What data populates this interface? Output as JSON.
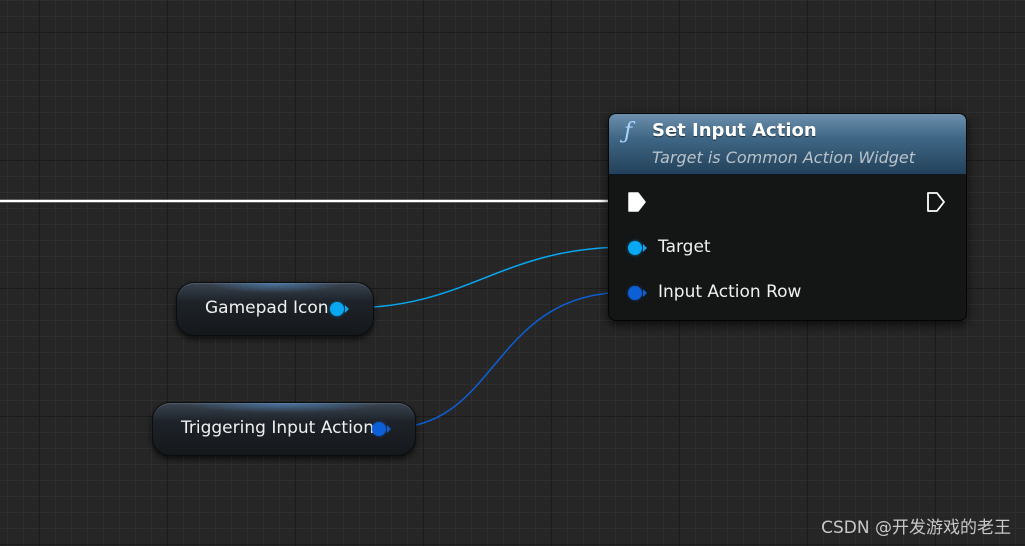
{
  "graph": {
    "background_color": "#262626",
    "grid_major_color": "#1b1b1b",
    "grid_minor_color": "#2e2e2e"
  },
  "function_node": {
    "icon": "function-f-icon",
    "icon_glyph": "ƒ",
    "title": "Set Input Action",
    "subtitle": "Target is Common Action Widget",
    "header_color": "#3f6785",
    "pins": {
      "exec_in": "exec-in-pin",
      "exec_out": "exec-out-pin",
      "target_label": "Target",
      "input_action_row_label": "Input Action Row"
    }
  },
  "variable_nodes": [
    {
      "label": "Gamepad Icon",
      "pin_color": "#07a7f2"
    },
    {
      "label": "Triggering Input Action",
      "pin_color": "#0d5fd6"
    }
  ],
  "wires": {
    "exec_color": "#ffffff",
    "object_color": "#07a7f2",
    "struct_color": "#0d5fd6"
  },
  "watermark": "CSDN @开发游戏的老王"
}
